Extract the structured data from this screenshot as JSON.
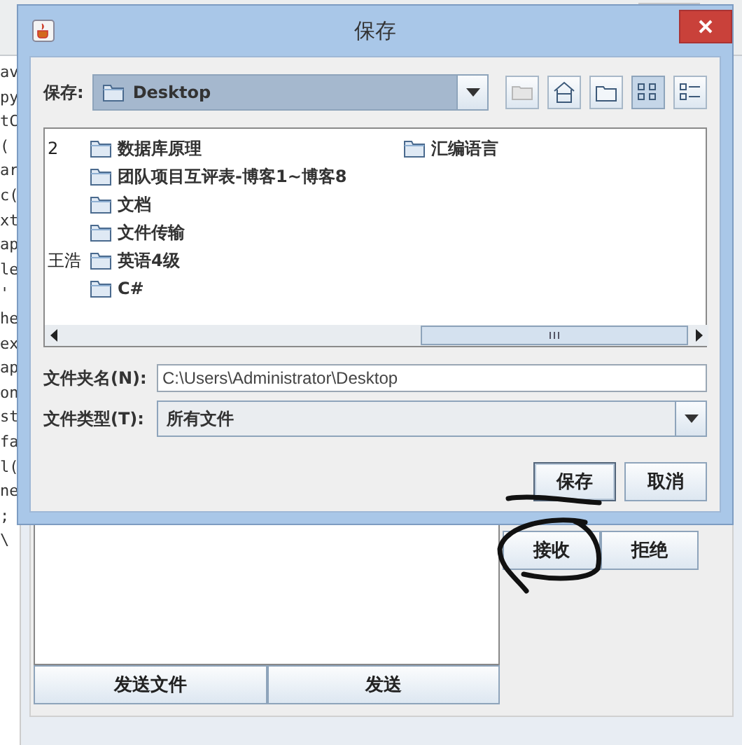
{
  "background_window": {
    "code_fragments": [
      "av",
      "py",
      "tC",
      "(",
      "ar",
      "c(",
      "xt",
      "ap",
      "le",
      "'",
      "he",
      "ex",
      "ap",
      "on",
      "st",
      "fa",
      "l(",
      "ne",
      ";",
      "\\"
    ],
    "buttons": [
      {
        "label": "接收",
        "kind": "side"
      },
      {
        "label": "拒绝",
        "kind": "side"
      },
      {
        "label": "发送文件",
        "kind": "bottom"
      },
      {
        "label": "发送",
        "kind": "bottom"
      }
    ]
  },
  "dialog": {
    "title": "保存",
    "save_in": {
      "label": "保存:",
      "value": "Desktop"
    },
    "toolbar": [
      {
        "kind": "up",
        "disabled": true,
        "selected": false
      },
      {
        "kind": "home",
        "disabled": false,
        "selected": false
      },
      {
        "kind": "new-folder",
        "disabled": false,
        "selected": false
      },
      {
        "kind": "list",
        "disabled": false,
        "selected": true
      },
      {
        "kind": "details",
        "disabled": false,
        "selected": false
      }
    ],
    "files": {
      "rows": [
        {
          "cut": "2",
          "name": "数据库原理"
        },
        {
          "name": "团队项目互评表-博客1~博客8"
        },
        {
          "name": "文档"
        },
        {
          "name": "文件传输"
        },
        {
          "cut": "王浩",
          "name": "英语4级"
        },
        {
          "name": "C#"
        }
      ],
      "column_2": [
        "汇编语言"
      ]
    },
    "file_name": {
      "label": "文件夹名(N):",
      "value": "C:\\Users\\Administrator\\Desktop"
    },
    "file_type": {
      "label": "文件类型(T):",
      "value": "所有文件"
    },
    "buttons": [
      {
        "label": "保存",
        "default": true
      },
      {
        "label": "取消",
        "default": false
      }
    ]
  }
}
